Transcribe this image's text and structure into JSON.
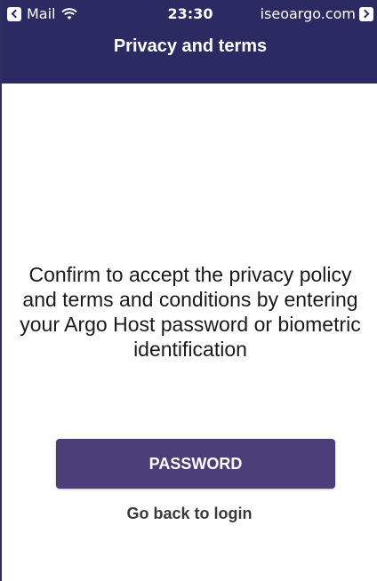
{
  "status_bar": {
    "back_app": "Mail",
    "time": "23:30",
    "host": "iseoargo.com",
    "wifi_icon": "wifi-icon",
    "back_icon": "chevron-left-icon",
    "forward_icon": "chevron-right-icon"
  },
  "nav": {
    "title": "Privacy and terms"
  },
  "main": {
    "message": "Confirm to accept the privacy policy and terms and conditions by entering your Argo Host password or biometric identification",
    "password_button": "PASSWORD",
    "back_link": "Go back to login"
  },
  "colors": {
    "header": "#2b2a63",
    "button": "#4a3d78",
    "text": "#1a1a1a"
  }
}
